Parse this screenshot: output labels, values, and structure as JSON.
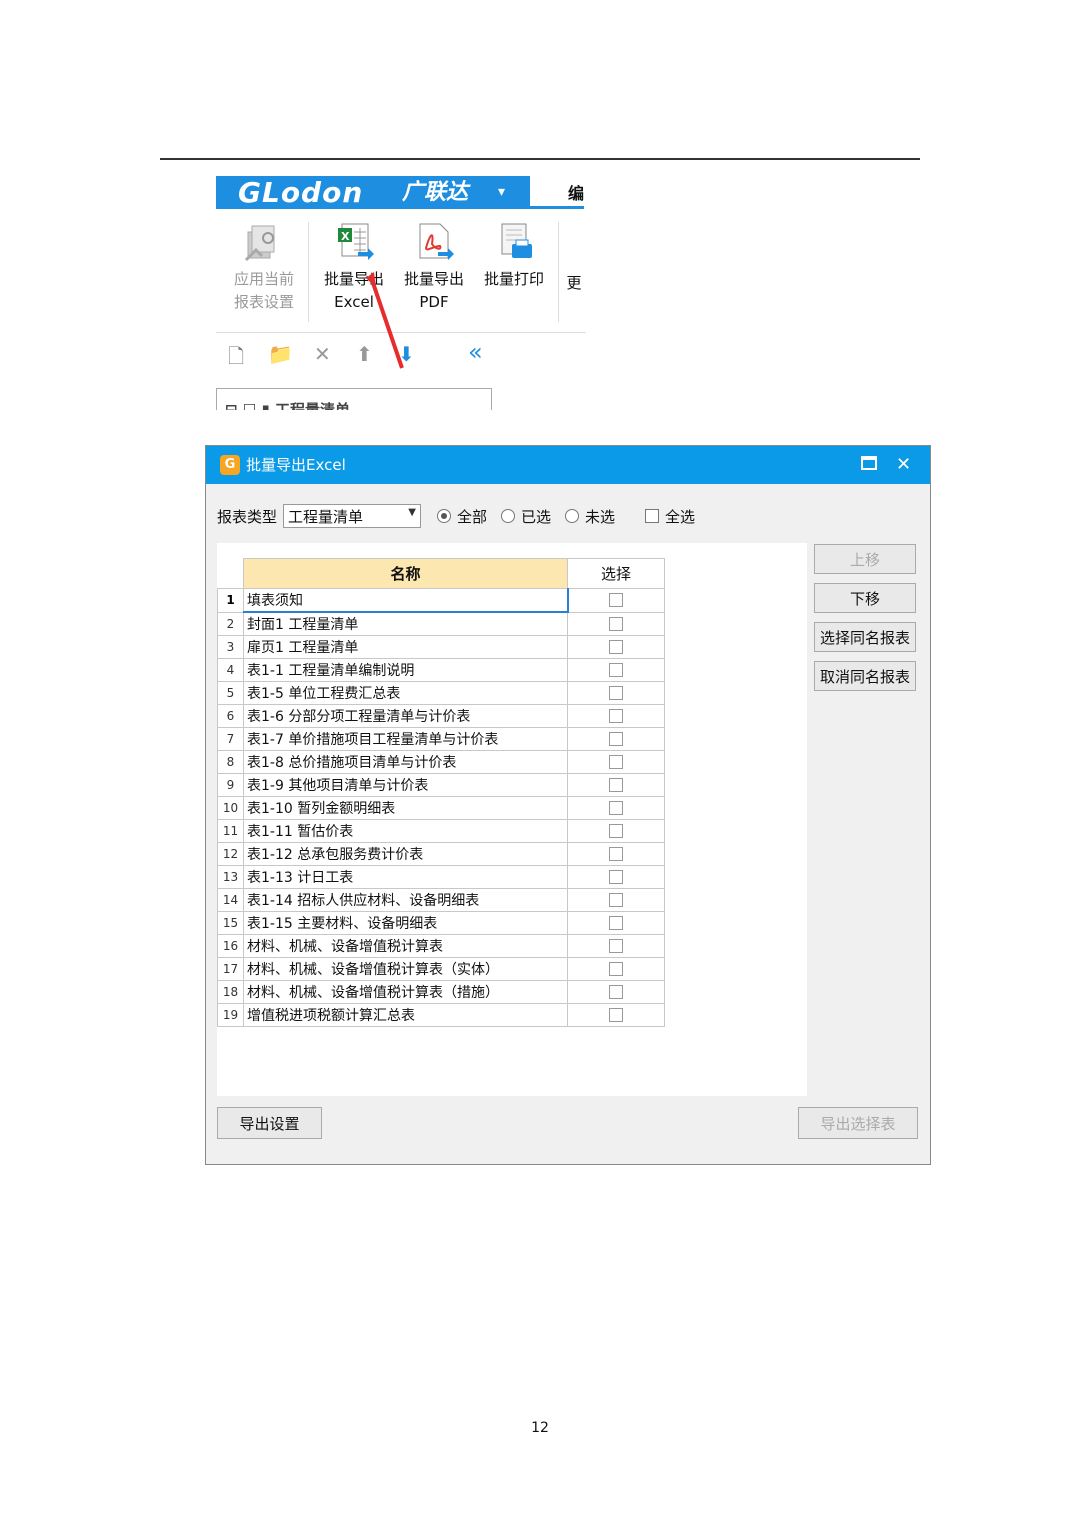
{
  "ribbon": {
    "brand_logo": "GLodon",
    "brand_cn": "广联达",
    "brand_caret": "▾",
    "edit_tab": "编",
    "tools": [
      {
        "line1": "应用当前",
        "line2": "报表设置"
      },
      {
        "line1": "批量导出",
        "line2": "Excel"
      },
      {
        "line1": "批量导出",
        "line2": "PDF"
      },
      {
        "line1": "批量打印",
        "line2": ""
      },
      {
        "line1": "更",
        "line2": ""
      }
    ],
    "tree_text": "工程量清单"
  },
  "dialog": {
    "title": "批量导出Excel",
    "filter": {
      "type_label": "报表类型",
      "type_value": "工程量清单",
      "radio_all": "全部",
      "radio_selected": "已选",
      "radio_unselected": "未选",
      "check_all": "全选"
    },
    "grid": {
      "col_name": "名称",
      "col_select": "选择",
      "rows": [
        {
          "num": "1",
          "name": "填表须知"
        },
        {
          "num": "2",
          "name": "封面1 工程量清单"
        },
        {
          "num": "3",
          "name": "扉页1 工程量清单"
        },
        {
          "num": "4",
          "name": "表1-1 工程量清单编制说明"
        },
        {
          "num": "5",
          "name": "表1-5 单位工程费汇总表"
        },
        {
          "num": "6",
          "name": "表1-6 分部分项工程量清单与计价表"
        },
        {
          "num": "7",
          "name": "表1-7 单价措施项目工程量清单与计价表"
        },
        {
          "num": "8",
          "name": "表1-8 总价措施项目清单与计价表"
        },
        {
          "num": "9",
          "name": "表1-9 其他项目清单与计价表"
        },
        {
          "num": "10",
          "name": "表1-10 暂列金额明细表"
        },
        {
          "num": "11",
          "name": "表1-11 暂估价表"
        },
        {
          "num": "12",
          "name": "表1-12 总承包服务费计价表"
        },
        {
          "num": "13",
          "name": "表1-13 计日工表"
        },
        {
          "num": "14",
          "name": "表1-14 招标人供应材料、设备明细表"
        },
        {
          "num": "15",
          "name": "表1-15 主要材料、设备明细表"
        },
        {
          "num": "16",
          "name": "材料、机械、设备增值税计算表"
        },
        {
          "num": "17",
          "name": "材料、机械、设备增值税计算表（实体）"
        },
        {
          "num": "18",
          "name": "材料、机械、设备增值税计算表（措施）"
        },
        {
          "num": "19",
          "name": "增值税进项税额计算汇总表"
        }
      ]
    },
    "buttons": {
      "move_up": "上移",
      "move_down": "下移",
      "select_same": "选择同名报表",
      "cancel_same": "取消同名报表",
      "export_settings": "导出设置",
      "export_selected": "导出选择表"
    }
  },
  "page_number": "12"
}
